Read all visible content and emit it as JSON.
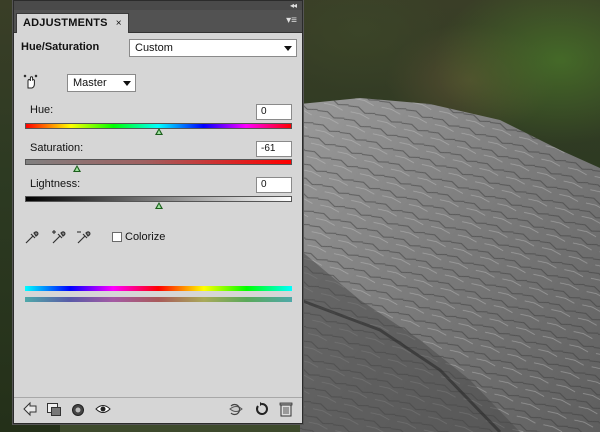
{
  "panel": {
    "tab_label": "ADJUSTMENTS",
    "tab_close": "×",
    "collapse_glyph": "◂◂",
    "menu_glyph": "▾≡",
    "title": "Hue/Saturation",
    "preset_value": "Custom",
    "channel_value": "Master",
    "hue": {
      "label": "Hue:",
      "value": "0",
      "level": 0.5
    },
    "saturation": {
      "label": "Saturation:",
      "value": "-61",
      "level": 0.195
    },
    "lightness": {
      "label": "Lightness:",
      "value": "0",
      "level": 0.5
    },
    "colorize_label": "Colorize",
    "colorize_checked": false
  },
  "icons": {
    "targeted_adjust": "hand-adjust-icon",
    "eyedroppers": [
      "eyedropper-icon",
      "eyedropper-add-icon",
      "eyedropper-subtract-icon"
    ],
    "footer": [
      "back-arrow-icon",
      "clip-to-layer-icon",
      "layer-mask-icon",
      "visibility-eye-icon",
      "view-previous-icon",
      "reset-icon",
      "trash-icon"
    ]
  },
  "colors": {
    "panel_bg": "#d6d6d6",
    "tab_strip": "#525252",
    "thumb": "#1b5e1b"
  }
}
